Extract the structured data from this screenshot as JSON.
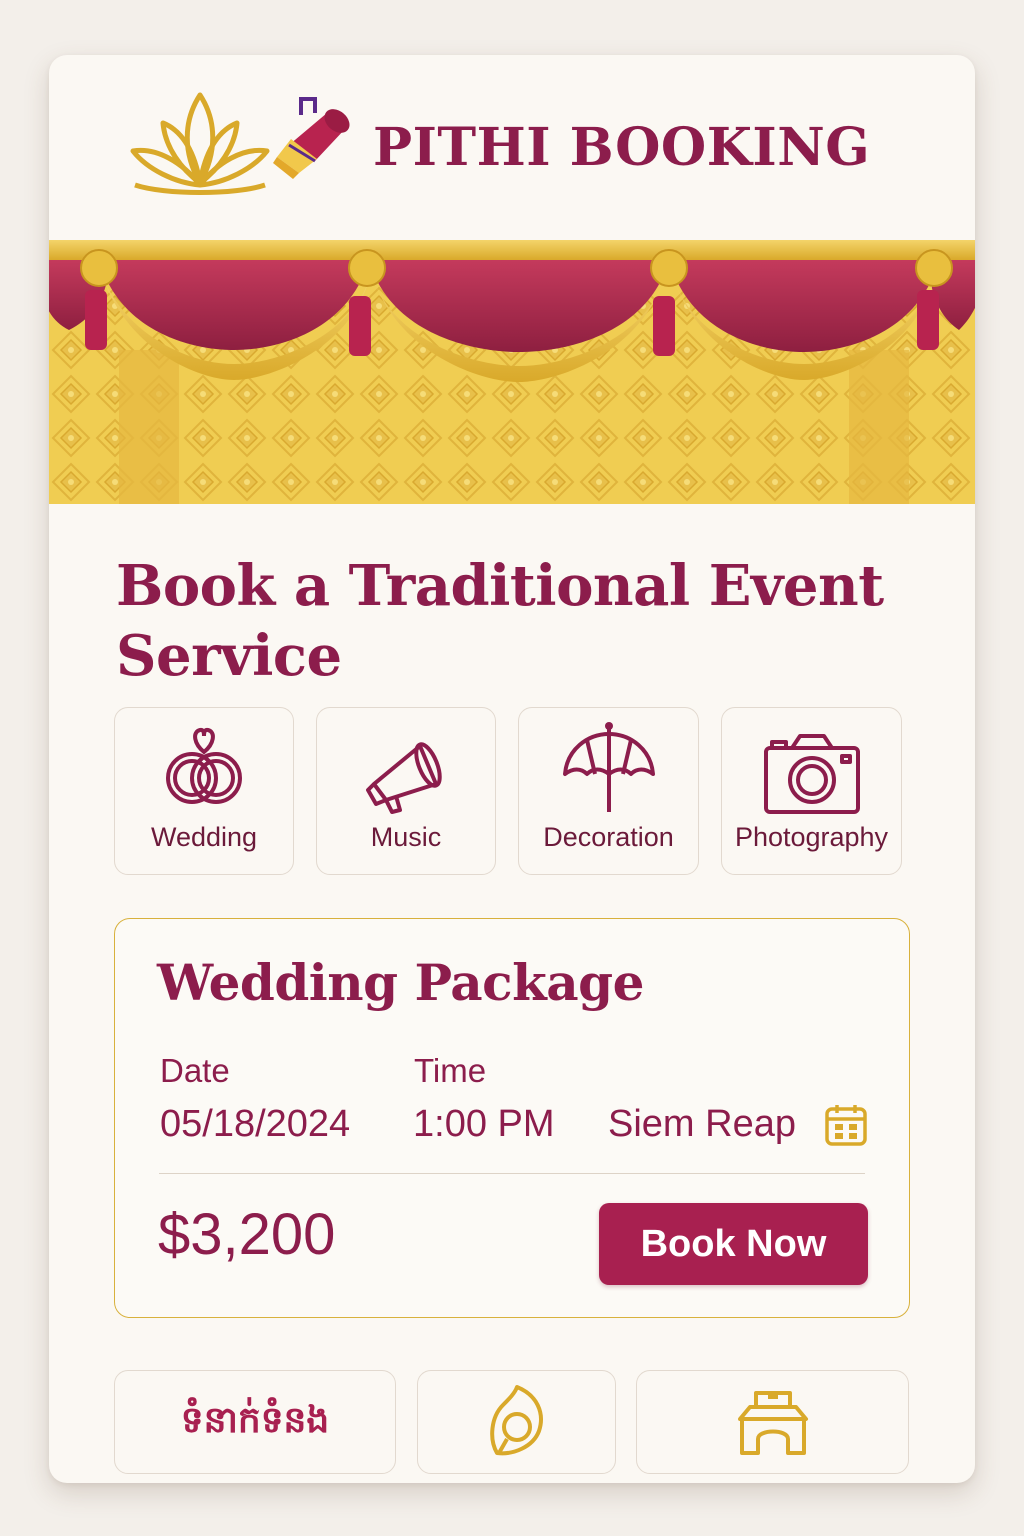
{
  "brand": {
    "name": "PITHI BOOKING",
    "logo_icons": [
      "lotus-icon",
      "horn-icon"
    ]
  },
  "colors": {
    "primary": "#8c1d4c",
    "button": "#a82050",
    "gold": "#d8b13c",
    "background": "#fbf8f3"
  },
  "banner": {
    "description_icon": "curtain-banner"
  },
  "main": {
    "title": "Book a Traditional Event Service"
  },
  "categories": [
    {
      "label": "Wedding",
      "icon": "wedding-rings-icon"
    },
    {
      "label": "Music",
      "icon": "megaphone-icon"
    },
    {
      "label": "Decoration",
      "icon": "umbrella-icon"
    },
    {
      "label": "Photography",
      "icon": "camera-icon"
    }
  ],
  "package": {
    "title": "Wedding Package",
    "date_label": "Date",
    "date_value": "05/18/2024",
    "time_label": "Time",
    "time_value": "1:00 PM",
    "location": "Siem Reap",
    "price": "$3,200",
    "book_label": "Book Now"
  },
  "bottom_nav": {
    "khmer_label": "ទំនាក់ទំនង",
    "items": [
      "khmer-text-tab",
      "leaf-icon",
      "temple-icon"
    ]
  }
}
